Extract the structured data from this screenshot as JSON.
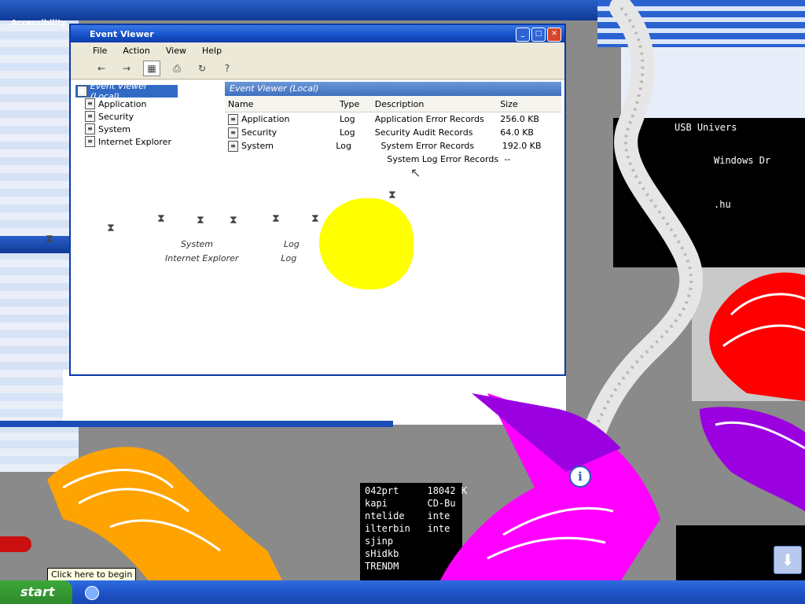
{
  "background_window": {
    "title": "Accessibility"
  },
  "event_viewer": {
    "window_title": "Event Viewer",
    "menu": [
      "File",
      "Action",
      "View",
      "Help"
    ],
    "toolbar_icons": [
      "back-icon",
      "forward-icon",
      "console-tree-icon",
      "print-icon",
      "refresh-icon",
      "help-icon"
    ],
    "tree": {
      "root": "Event Viewer (Local)",
      "items": [
        "Application",
        "Security",
        "System",
        "Internet Explorer"
      ]
    },
    "list_header": "Event Viewer (Local)",
    "columns": [
      "Name",
      "Type",
      "Description",
      "Size"
    ],
    "rows": [
      {
        "name": "Application",
        "type": "Log",
        "description": "Application Error Records",
        "size": "256.0 KB"
      },
      {
        "name": "Security",
        "type": "Log",
        "description": "Security Audit Records",
        "size": "64.0 KB"
      },
      {
        "name": "System",
        "type": "Log",
        "description": "System Error Records",
        "size": "192.0 KB"
      },
      {
        "name": "",
        "type": "",
        "description": "System Log Error Records",
        "size": "--"
      }
    ],
    "ghost_rows": [
      {
        "name": "System",
        "type": "Log"
      },
      {
        "name": "Internet Explorer",
        "type": "Log"
      }
    ]
  },
  "console_text": {
    "top_right": "USB Univers",
    "top_right_2": "Windows Dr",
    "lines": [
      "042prt     18042 K",
      "kapi       CD-Bu",
      "ntelide    inte",
      "ilterbin   inte",
      "sjinp",
      "sHidkb",
      "TRENDM"
    ],
    "file_ext": ".hu"
  },
  "tooltip": "Click here to begin",
  "taskbar": {
    "start_label": "start"
  },
  "colors": {
    "xp_blue": "#1450c8",
    "orange": "#ffa300",
    "magenta": "#ff00ff",
    "purple": "#9a00e0",
    "red": "#ff0000",
    "yellow": "#ffff00"
  }
}
